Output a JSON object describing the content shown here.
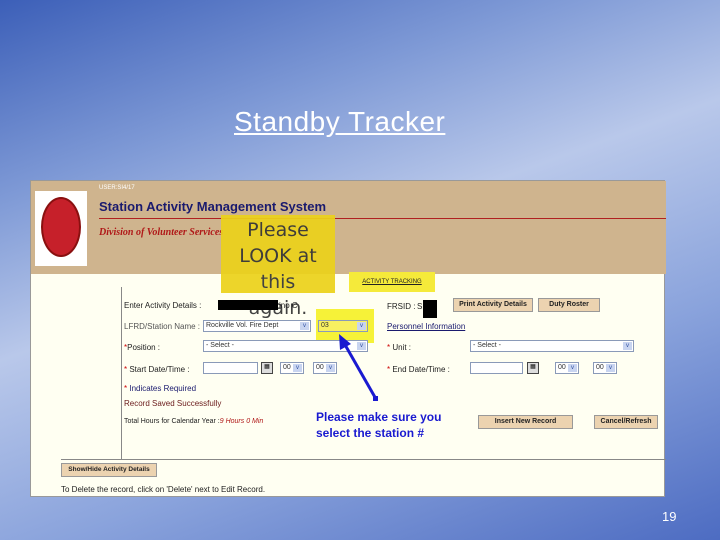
{
  "slide": {
    "title": "Standby Tracker",
    "page_number": "19"
  },
  "app": {
    "user": "USER:SI4/17",
    "name": "Station Activity Management System",
    "division": "Division of Volunteer Services",
    "activity_link": "ACTIVITY TRACKING"
  },
  "annotations": {
    "look_note": [
      "Please",
      "LOOK at this",
      "again."
    ],
    "station_note": [
      "Please make sure you",
      "select the station #"
    ]
  },
  "form": {
    "enter_label": "Enter Activity Details :",
    "enter_name_suffix": "ino C",
    "frsid_label": "FRSID :",
    "frsid_value": "S",
    "print_button": "Print Activity Details",
    "roster_button": "Duty Roster",
    "station_label": "LFRD/Station Name :",
    "station_value": "Rockville Vol. Fire Dept",
    "station_number": "03",
    "personnel_link": "Personnel Information",
    "position_label": "Position :",
    "position_value": "- Select -",
    "unit_label": "Unit :",
    "unit_value": "- Select -",
    "start_label": "Start Date/Time :",
    "end_label": "End Date/Time :",
    "hour": "00",
    "minute": "00",
    "required_note": "Indicates Required",
    "saved_msg": "Record Saved Successfully",
    "total_label": "Total Hours for Calendar Year :",
    "total_value": "9 Hours 0 Min",
    "insert_button": "Insert New Record",
    "cancel_button": "Cancel/Refresh",
    "showhide_button": "Show/Hide Activity Details",
    "delete_hint": "To Delete the record, click on 'Delete' next to Edit Record."
  }
}
